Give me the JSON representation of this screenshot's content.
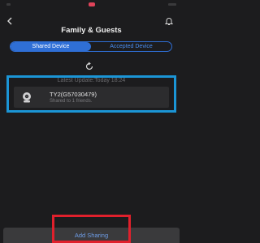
{
  "header": {
    "title": "Family & Guests"
  },
  "tabs": [
    {
      "label": "Shared Device",
      "active": true
    },
    {
      "label": "Accepted Device",
      "active": false
    }
  ],
  "device_list": {
    "last_update": "Latest Update:Today 18:24",
    "items": [
      {
        "name": "TY2(G57030479)",
        "status": "Shared to 1 friends."
      }
    ]
  },
  "footer": {
    "add_label": "Add Sharing"
  },
  "colors": {
    "background": "#1c1c1e",
    "accent": "#2f6fd6",
    "highlight_blue": "#1b95d6",
    "highlight_red": "#e0202c"
  },
  "icons": [
    "back-arrow-icon",
    "bell-icon",
    "refresh-icon",
    "camera-icon"
  ]
}
